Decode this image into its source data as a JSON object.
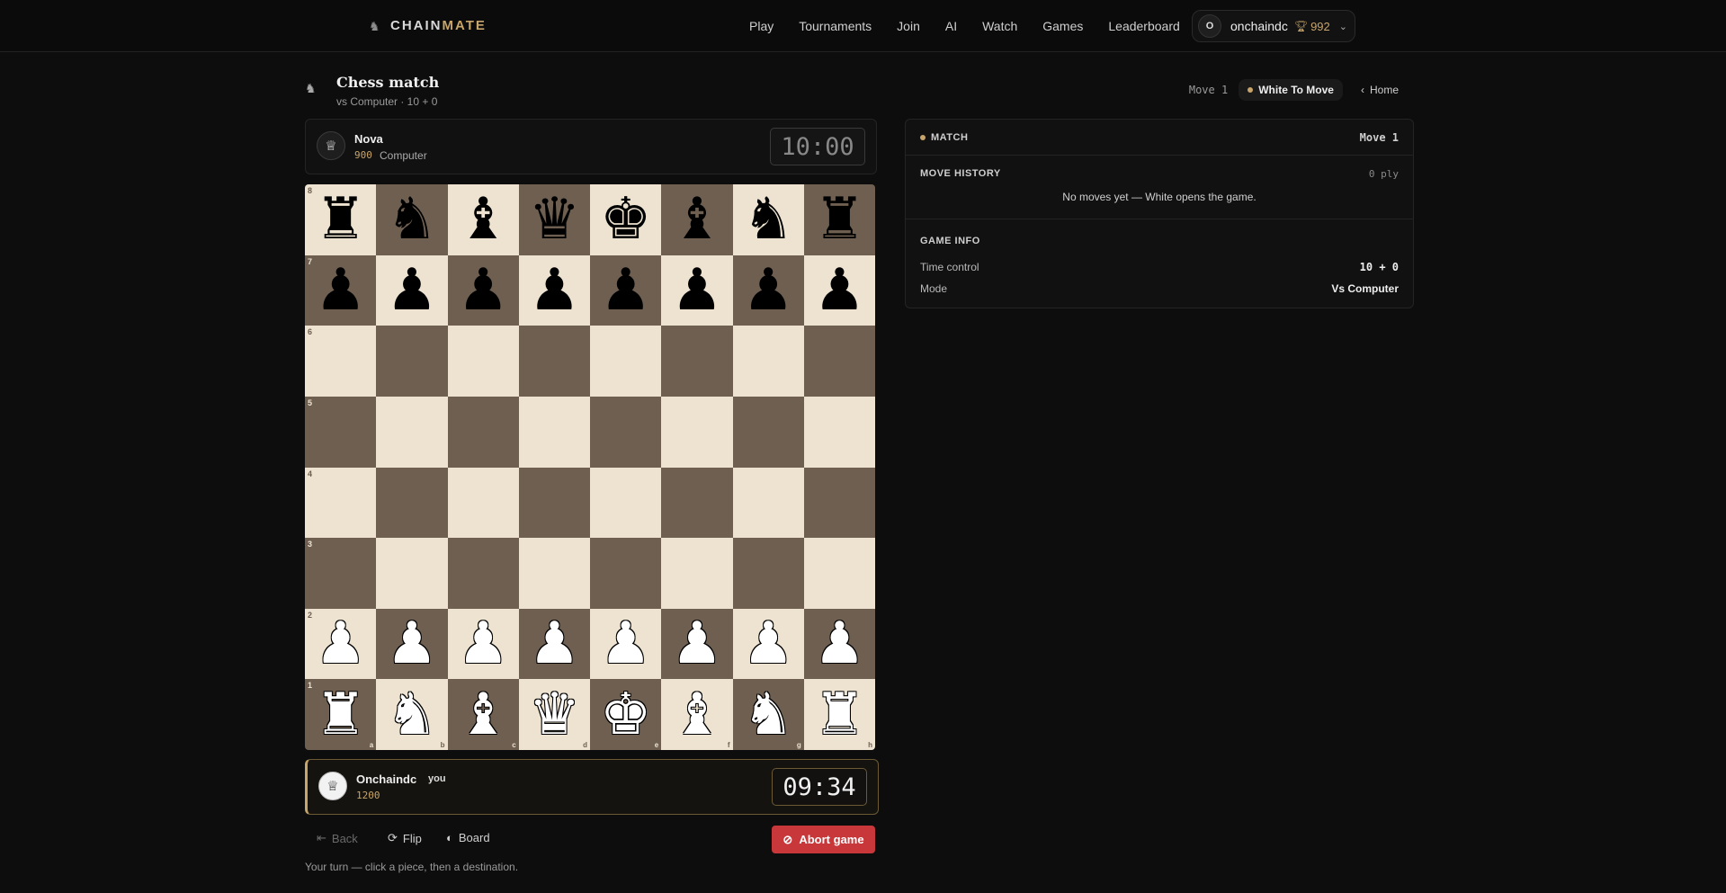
{
  "nav": {
    "brand_part1": "CHAIN",
    "brand_part2": "MATE",
    "links": [
      "Play",
      "Tournaments",
      "Join",
      "AI",
      "Watch",
      "Games",
      "Leaderboard"
    ],
    "user": {
      "avatar_initial": "O",
      "name": "onchaindc",
      "rating": "992"
    }
  },
  "header": {
    "title": "Chess match",
    "subtitle": "vs Computer · 10 + 0",
    "move_label": "Move 1",
    "turn": "White To Move",
    "home": "Home"
  },
  "opponent": {
    "name": "Nova",
    "rating": "900",
    "kind": "Computer",
    "clock": "10:00"
  },
  "player": {
    "name": "Onchaindc",
    "tag": "you",
    "rating": "1200",
    "clock": "09:34"
  },
  "board": {
    "light_color": "#ede3d0",
    "dark_color": "#6e5f51",
    "ranks": [
      "8",
      "7",
      "6",
      "5",
      "4",
      "3",
      "2",
      "1"
    ],
    "files": [
      "a",
      "b",
      "c",
      "d",
      "e",
      "f",
      "g",
      "h"
    ],
    "position": [
      [
        "r",
        "n",
        "b",
        "q",
        "k",
        "b",
        "n",
        "r"
      ],
      [
        "p",
        "p",
        "p",
        "p",
        "p",
        "p",
        "p",
        "p"
      ],
      [
        "",
        "",
        "",
        "",
        "",
        "",
        "",
        ""
      ],
      [
        "",
        "",
        "",
        "",
        "",
        "",
        "",
        ""
      ],
      [
        "",
        "",
        "",
        "",
        "",
        "",
        "",
        ""
      ],
      [
        "",
        "",
        "",
        "",
        "",
        "",
        "",
        ""
      ],
      [
        "P",
        "P",
        "P",
        "P",
        "P",
        "P",
        "P",
        "P"
      ],
      [
        "R",
        "N",
        "B",
        "Q",
        "K",
        "B",
        "N",
        "R"
      ]
    ]
  },
  "controls": {
    "back": "Back",
    "flip": "Flip",
    "board": "Board",
    "abort": "Abort game"
  },
  "hint": "Your turn — click a piece, then a destination.",
  "panel": {
    "match_label": "MATCH",
    "match_move": "Move 1",
    "history_label": "MOVE HISTORY",
    "ply": "0 ply",
    "empty": "No moves yet — White opens the game.",
    "info_label": "GAME INFO",
    "time_control_label": "Time control",
    "time_control_value": "10 + 0",
    "mode_label": "Mode",
    "mode_value": "Vs Computer"
  },
  "colors": {
    "accent": "#c8a56a",
    "abort": "#c8373a"
  }
}
